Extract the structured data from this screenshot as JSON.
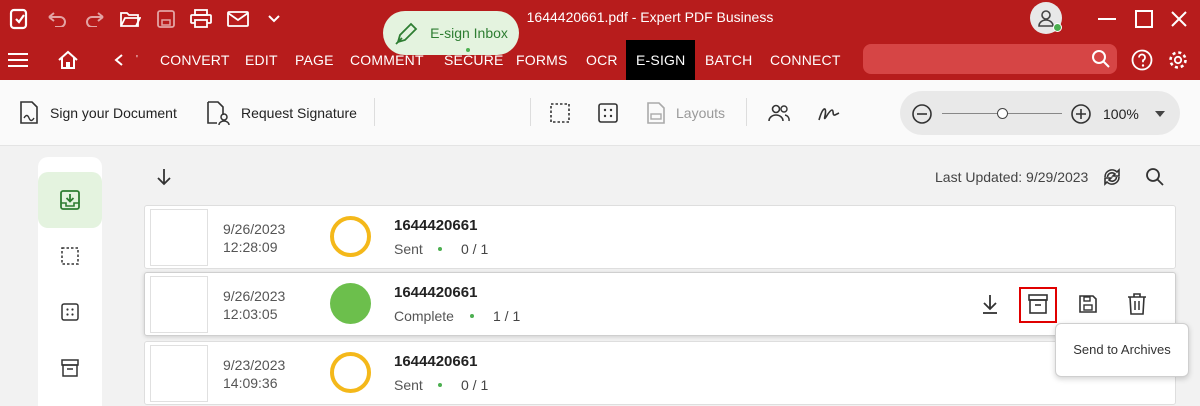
{
  "titlebar": {
    "title": "1644420661.pdf  -  Expert PDF Business",
    "icons": [
      "app-logo-icon",
      "undo-icon",
      "redo-icon",
      "open-folder-icon",
      "save-icon",
      "print-icon",
      "email-icon",
      "chevron-down-icon",
      "user-icon",
      "minimize-icon",
      "maximize-icon",
      "close-icon"
    ]
  },
  "menubar": {
    "items": [
      "CONVERT",
      "EDIT",
      "PAGE",
      "COMMENT",
      "SECURE",
      "FORMS",
      "OCR",
      "E-SIGN",
      "BATCH",
      "CONNECT"
    ],
    "active": "E-SIGN",
    "truncated_prev": "'"
  },
  "toolbar": {
    "sign_document": "Sign your Document",
    "request_signature": "Request Signature",
    "esign_inbox": "E-sign Inbox",
    "layouts": "Layouts",
    "zoom": "100%"
  },
  "content": {
    "last_updated": "Last Updated: 9/29/2023",
    "rows": [
      {
        "date": "9/26/2023",
        "time": "12:28:09",
        "name": "1644420661",
        "status": "Sent",
        "count": "0 / 1",
        "state": "pending"
      },
      {
        "date": "9/26/2023",
        "time": "12:03:05",
        "name": "1644420661",
        "status": "Complete",
        "count": "1 / 1",
        "state": "complete"
      },
      {
        "date": "9/23/2023",
        "time": "14:09:36",
        "name": "1644420661",
        "status": "Sent",
        "count": "0 / 1",
        "state": "pending"
      }
    ],
    "tooltip": "Send to Archives"
  },
  "colors": {
    "brand_red": "#b71c1c",
    "accent_green": "#4caf50",
    "pending_ring": "#f4b81a",
    "complete_fill": "#6cbf4c",
    "highlight": "#e00000"
  }
}
